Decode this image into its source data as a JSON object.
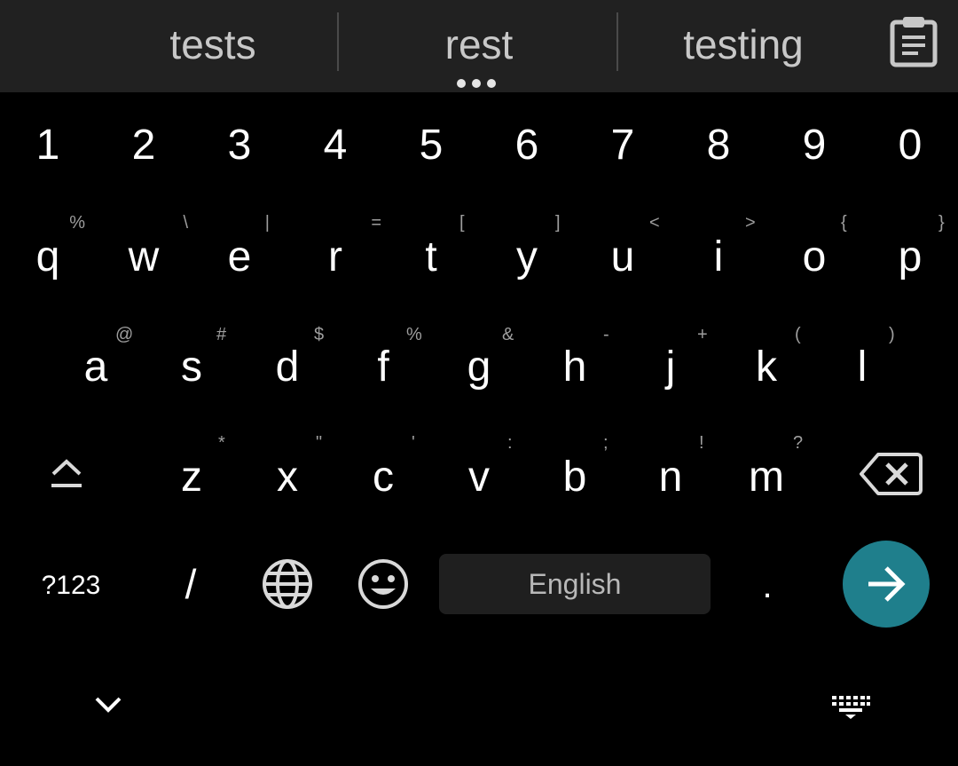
{
  "suggestions": [
    "tests",
    "rest",
    "testing"
  ],
  "number_row": [
    "1",
    "2",
    "3",
    "4",
    "5",
    "6",
    "7",
    "8",
    "9",
    "0"
  ],
  "row1": [
    {
      "key": "q",
      "hint": "%"
    },
    {
      "key": "w",
      "hint": "\\"
    },
    {
      "key": "e",
      "hint": "|"
    },
    {
      "key": "r",
      "hint": "="
    },
    {
      "key": "t",
      "hint": "["
    },
    {
      "key": "y",
      "hint": "]"
    },
    {
      "key": "u",
      "hint": "<"
    },
    {
      "key": "i",
      "hint": ">"
    },
    {
      "key": "o",
      "hint": "{"
    },
    {
      "key": "p",
      "hint": "}"
    }
  ],
  "row2": [
    {
      "key": "a",
      "hint": "@"
    },
    {
      "key": "s",
      "hint": "#"
    },
    {
      "key": "d",
      "hint": "$"
    },
    {
      "key": "f",
      "hint": "%"
    },
    {
      "key": "g",
      "hint": "&"
    },
    {
      "key": "h",
      "hint": "-"
    },
    {
      "key": "j",
      "hint": "+"
    },
    {
      "key": "k",
      "hint": "("
    },
    {
      "key": "l",
      "hint": ")"
    }
  ],
  "row3": [
    {
      "key": "z",
      "hint": "*"
    },
    {
      "key": "x",
      "hint": "\""
    },
    {
      "key": "c",
      "hint": "'"
    },
    {
      "key": "v",
      "hint": ":"
    },
    {
      "key": "b",
      "hint": ";"
    },
    {
      "key": "n",
      "hint": "!"
    },
    {
      "key": "m",
      "hint": "?"
    }
  ],
  "bottom": {
    "symbols_label": "?123",
    "slash_label": "/",
    "space_label": "English",
    "period_label": "."
  },
  "icons": {
    "clipboard": "clipboard-icon",
    "shift": "shift-icon",
    "backspace": "backspace-icon",
    "globe": "globe-icon",
    "emoji": "emoji-icon",
    "enter": "arrow-right-icon",
    "hide": "chevron-down-icon",
    "switch_keyboard": "keyboard-icon"
  },
  "colors": {
    "background": "#000000",
    "suggestion_bar": "#212121",
    "enter_key": "#1f7f8c",
    "space_key": "#1f1f1f"
  }
}
